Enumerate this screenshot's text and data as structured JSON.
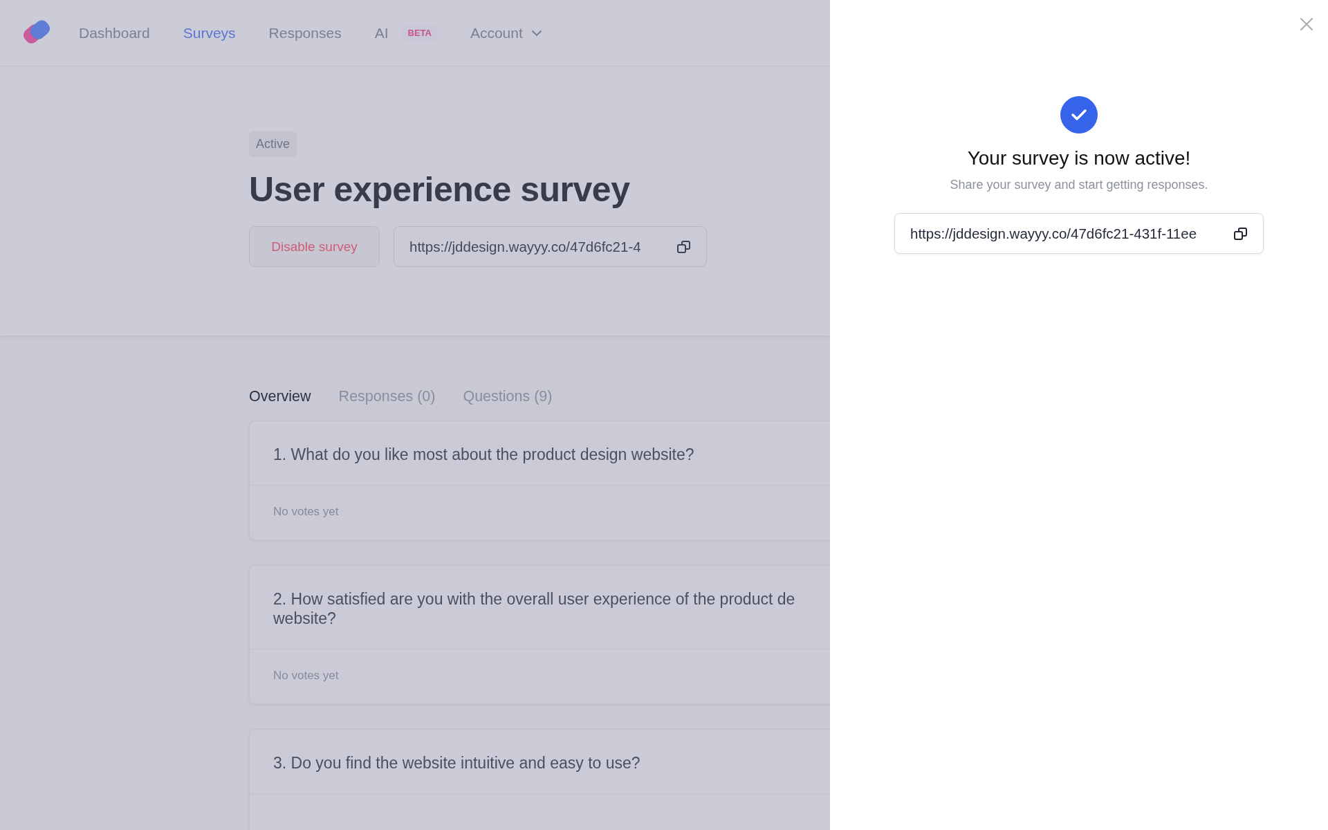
{
  "nav": {
    "items": [
      {
        "label": "Dashboard",
        "selected": false
      },
      {
        "label": "Surveys",
        "selected": true
      },
      {
        "label": "Responses",
        "selected": false
      },
      {
        "label": "AI",
        "selected": false,
        "badge": "BETA"
      },
      {
        "label": "Account",
        "selected": false,
        "dropdown": true
      }
    ]
  },
  "survey": {
    "status": "Active",
    "title": "User experience survey",
    "disable_button": "Disable survey",
    "link": "https://jddesign.wayyy.co/47d6fc21-4"
  },
  "tabs": [
    {
      "label": "Overview",
      "selected": true
    },
    {
      "label": "Responses (0)",
      "selected": false
    },
    {
      "label": "Questions (9)",
      "selected": false
    }
  ],
  "questions": [
    {
      "lines": [
        "1. What do you like most about the product design website?"
      ],
      "result": "No votes yet"
    },
    {
      "lines": [
        "2. How satisfied are you with the overall user experience of the product de",
        "website?"
      ],
      "result": "No votes yet"
    },
    {
      "lines": [
        "3. Do you find the website intuitive and easy to use?"
      ]
    }
  ],
  "panel": {
    "heading": "Your survey is now active!",
    "subtitle": "Share your survey and start getting responses.",
    "link": "https://jddesign.wayyy.co/47d6fc21-431f-11ee"
  }
}
